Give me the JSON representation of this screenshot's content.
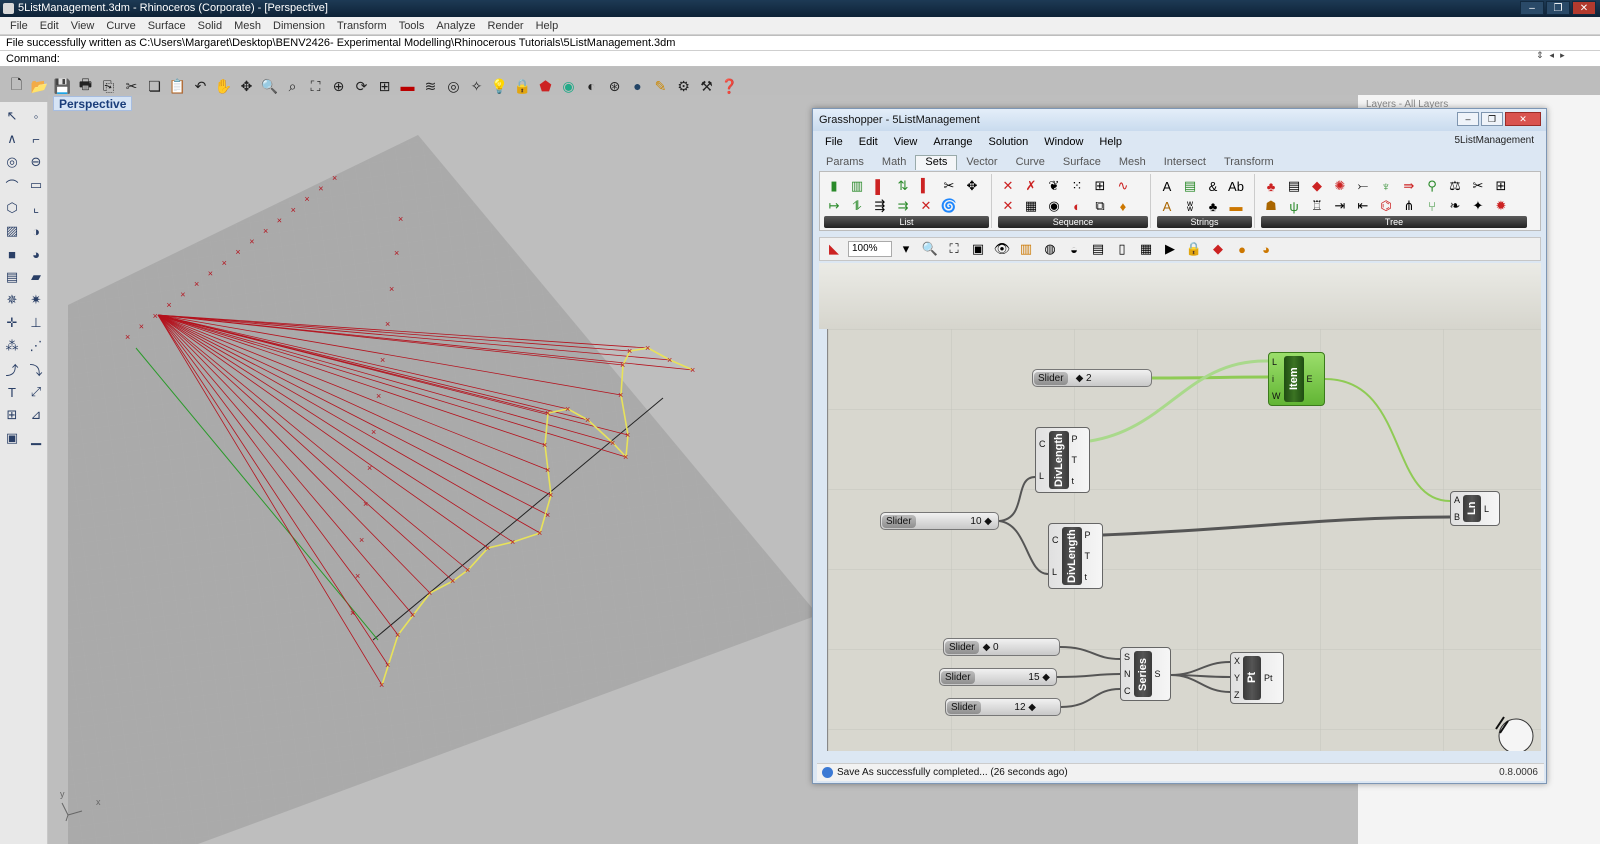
{
  "window": {
    "title": "5ListManagement.3dm - Rhinoceros (Corporate) - [Perspective]"
  },
  "menu": [
    "File",
    "Edit",
    "View",
    "Curve",
    "Surface",
    "Solid",
    "Mesh",
    "Dimension",
    "Transform",
    "Tools",
    "Analyze",
    "Render",
    "Help"
  ],
  "command_history": "File successfully written as C:\\Users\\Margaret\\Desktop\\BENV2426- Experimental Modelling\\Rhinocerous Tutorials\\5ListManagement.3dm",
  "command_prompt": "Command:",
  "viewport": {
    "name": "Perspective"
  },
  "layers_panel": {
    "label": "Layers - All Layers"
  },
  "toolbar_icons": [
    "new-icon",
    "open-icon",
    "save-icon",
    "print-icon",
    "import-icon",
    "cut-icon",
    "copy-icon",
    "paste-icon",
    "undo-icon",
    "pan-hand-icon",
    "rotate-view-icon",
    "zoom-icon",
    "zoom-window-icon",
    "zoom-extents-icon",
    "zoom-selected-icon",
    "rotate-icon",
    "four-view-icon",
    "car-icon",
    "wire-icon",
    "select-icon",
    "point-icon",
    "light-icon",
    "lock-icon",
    "render-icon",
    "color-wheel-icon",
    "sphere-icon",
    "mesh-sphere-icon",
    "globe-icon",
    "paint-icon",
    "gear-icon",
    "options-icon",
    "help-icon"
  ],
  "grasshopper": {
    "title": "Grasshopper - 5ListManagement",
    "document": "5ListManagement",
    "menu": [
      "File",
      "Edit",
      "View",
      "Arrange",
      "Solution",
      "Window",
      "Help"
    ],
    "tabs": [
      "Params",
      "Math",
      "Sets",
      "Vector",
      "Curve",
      "Surface",
      "Mesh",
      "Intersect",
      "Transform"
    ],
    "active_tab": "Sets",
    "ribbon_groups": [
      "List",
      "Sequence",
      "Strings",
      "Tree"
    ],
    "zoom": "100%",
    "status": "Save As successfully completed... (26 seconds ago)",
    "version": "0.8.0006",
    "sliders": [
      {
        "label": "Slider",
        "value": "2"
      },
      {
        "label": "Slider",
        "value": "10"
      },
      {
        "label": "Slider",
        "value": "0"
      },
      {
        "label": "Slider",
        "value": "15"
      },
      {
        "label": "Slider",
        "value": "12"
      }
    ],
    "components": {
      "item": {
        "name": "Item",
        "inputs": [
          "L",
          "i",
          "W"
        ],
        "outputs": [
          "E"
        ]
      },
      "divlength1": {
        "name": "DivLength",
        "inputs": [
          "C",
          "L"
        ],
        "outputs": [
          "P",
          "T",
          "t"
        ]
      },
      "divlength2": {
        "name": "DivLength",
        "inputs": [
          "C",
          "L"
        ],
        "outputs": [
          "P",
          "T",
          "t"
        ]
      },
      "ln": {
        "name": "Ln",
        "inputs": [
          "A",
          "B"
        ],
        "outputs": [
          "L"
        ]
      },
      "series": {
        "name": "Series",
        "inputs": [
          "S",
          "N",
          "C"
        ],
        "outputs": [
          "S"
        ]
      },
      "pt": {
        "name": "Pt",
        "inputs": [
          "X",
          "Y",
          "Z"
        ],
        "outputs": [
          "Pt"
        ]
      }
    }
  },
  "colors": {
    "curve_red": "#b4121d",
    "yellow_curve": "#e8e25a",
    "wire_green": "#8fcb55",
    "wire_dark": "#555555"
  }
}
